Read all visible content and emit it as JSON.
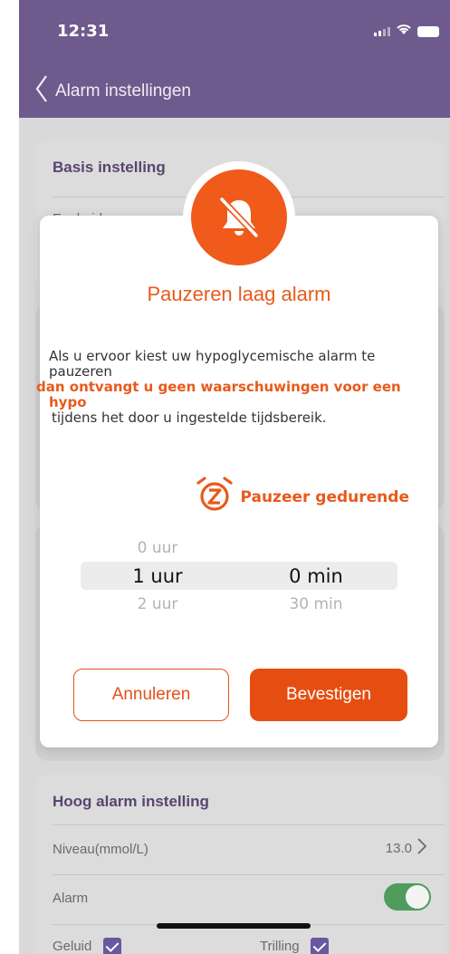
{
  "status_bar": {
    "time": "12:31"
  },
  "nav": {
    "title": "Alarm instellingen"
  },
  "background": {
    "basis_card": {
      "title": "Basis instelling",
      "row_label": "Eenheid",
      "row_value": "..."
    },
    "hoog_card": {
      "title": "Hoog alarm instelling",
      "level_label": "Niveau(mmol/L)",
      "level_value": "13.0",
      "alarm_label": "Alarm",
      "sound_label": "Geluid",
      "vibration_label": "Trilling"
    }
  },
  "modal": {
    "title": "Pauzeren laag alarm",
    "body_line1": "Als u ervoor kiest uw hypoglycemische alarm te pauzeren",
    "body_highlight": "dan ontvangt u geen waarschuwingen voor een hypo",
    "body_line3": "tijdens het door u ingestelde tijdsbereik.",
    "pause_label": "Pauzeer gedurende",
    "picker": {
      "hours": [
        "0 uur",
        "1 uur",
        "2 uur"
      ],
      "minutes": [
        "",
        "0 min",
        "30 min"
      ]
    },
    "cancel_label": "Annuleren",
    "confirm_label": "Bevestigen"
  },
  "colors": {
    "accent": "#e85a1b",
    "nav_purple": "#6f5a8d",
    "toggle_green": "#4f9c5d"
  },
  "icons": [
    "chevron-left-icon",
    "bell-slash-icon",
    "alarm-clock-z-icon",
    "chevron-right-icon",
    "checkbox-icon"
  ]
}
